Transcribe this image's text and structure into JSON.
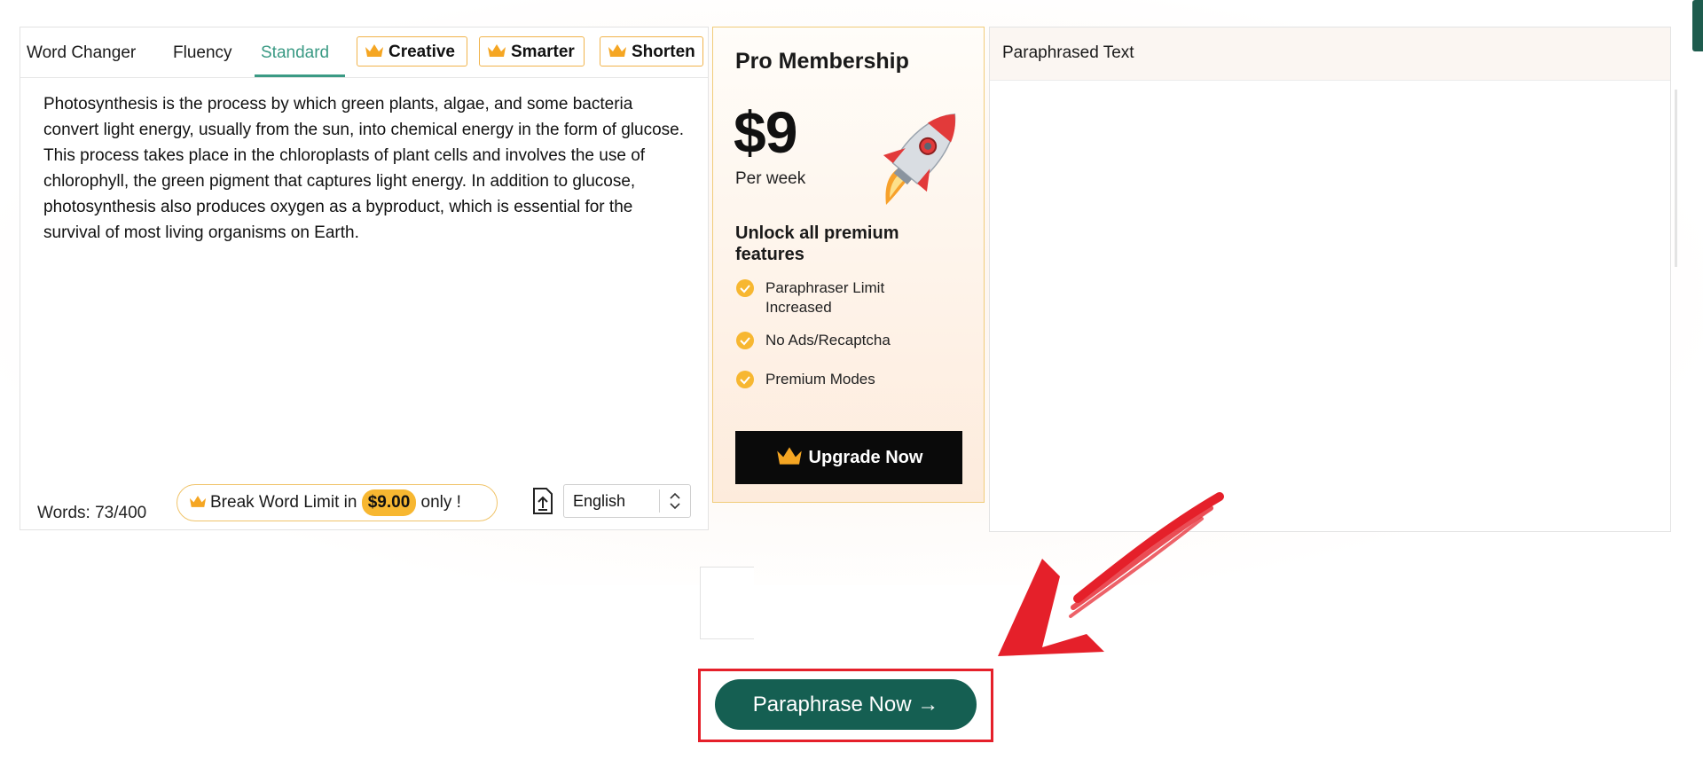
{
  "tabs": {
    "word_changer": "Word Changer",
    "fluency": "Fluency",
    "standard": "Standard",
    "creative": "Creative",
    "smarter": "Smarter",
    "shorten": "Shorten"
  },
  "input": {
    "text": "Photosynthesis is the process by which green plants, algae, and some bacteria convert light energy, usually from the sun, into chemical energy in the form of glucose. This process takes place in the chloroplasts of plant cells and involves the use of chlorophyll, the green pigment that captures light energy. In addition to glucose, photosynthesis also produces oxygen as a byproduct, which is essential for the survival of most living organisms on Earth.",
    "word_count": "Words: 73/400",
    "break_limit_prefix": "Break Word Limit in",
    "break_limit_price": "$9.00",
    "break_limit_suffix": "only !",
    "language": "English"
  },
  "pro": {
    "title": "Pro Membership",
    "price": "$9",
    "period": "Per week",
    "unlock": "Unlock all premium features",
    "features": [
      "Paraphraser Limit Increased",
      "No Ads/Recaptcha",
      "Premium Modes"
    ],
    "upgrade_label": "Upgrade Now"
  },
  "output": {
    "title": "Paraphrased Text"
  },
  "cta": {
    "label": "Paraphrase Now →"
  },
  "colors": {
    "accent": "#3a9a84",
    "button": "#155f52",
    "gold": "#f7b731",
    "highlight": "#e5202a"
  }
}
